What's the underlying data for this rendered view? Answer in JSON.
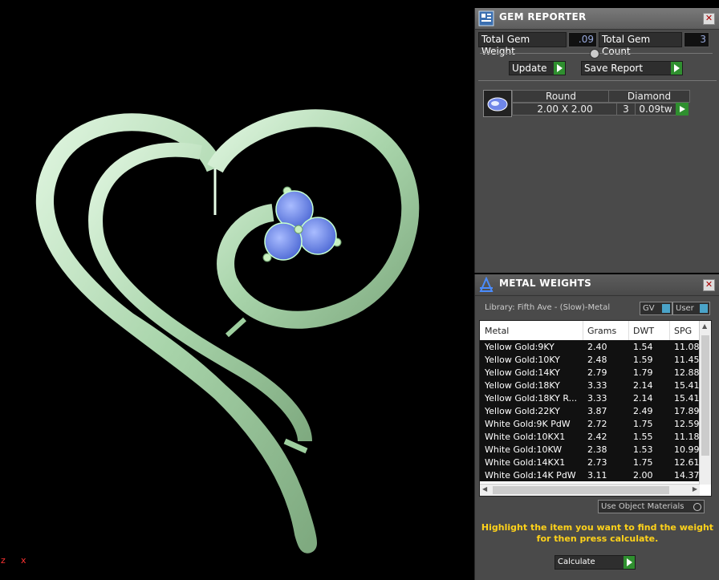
{
  "gem_reporter": {
    "title": "GEM REPORTER",
    "total_gem_weight_label": "Total Gem Weight",
    "total_gem_weight_value": ".09",
    "total_gem_count_label": "Total Gem Count",
    "total_gem_count_value": "3",
    "update_label": "Update",
    "save_report_label": "Save Report",
    "gem": {
      "cut": "Round",
      "material": "Diamond",
      "size": "2.00 X 2.00",
      "count": "3",
      "weight": "0.09tw"
    }
  },
  "metal_weights": {
    "title": "METAL WEIGHTS",
    "library_label": "Library: Fifth Ave - (Slow)-Metal",
    "gv_label": "GV",
    "user_label": "User",
    "columns": [
      "Metal",
      "Grams",
      "DWT",
      "SPG"
    ],
    "rows": [
      [
        "Yellow Gold:9KY",
        "2.40",
        "1.54",
        "11.08"
      ],
      [
        "Yellow Gold:10KY",
        "2.48",
        "1.59",
        "11.45"
      ],
      [
        "Yellow Gold:14KY",
        "2.79",
        "1.79",
        "12.88"
      ],
      [
        "Yellow Gold:18KY",
        "3.33",
        "2.14",
        "15.41"
      ],
      [
        "Yellow Gold:18KY R...",
        "3.33",
        "2.14",
        "15.41"
      ],
      [
        "Yellow Gold:22KY",
        "3.87",
        "2.49",
        "17.89"
      ],
      [
        "White Gold:9K PdW",
        "2.72",
        "1.75",
        "12.59"
      ],
      [
        "White Gold:10KX1",
        "2.42",
        "1.55",
        "11.18"
      ],
      [
        "White Gold:10KW",
        "2.38",
        "1.53",
        "10.99"
      ],
      [
        "White Gold:14KX1",
        "2.73",
        "1.75",
        "12.61"
      ],
      [
        "White Gold:14K PdW",
        "3.11",
        "2.00",
        "14.37"
      ]
    ],
    "use_object_materials_label": "Use Object Materials",
    "hint_line1": "Highlight the item you want to find the weight",
    "hint_line2": "for then press calculate.",
    "calculate_label": "Calculate"
  },
  "viewport": {
    "axis_x": "x",
    "axis_z": "z"
  },
  "colors": {
    "metal": "#bfe6c2",
    "gem": "#6f8cf0",
    "hint": "#ffd21a",
    "go_button": "#2f8f2f"
  }
}
